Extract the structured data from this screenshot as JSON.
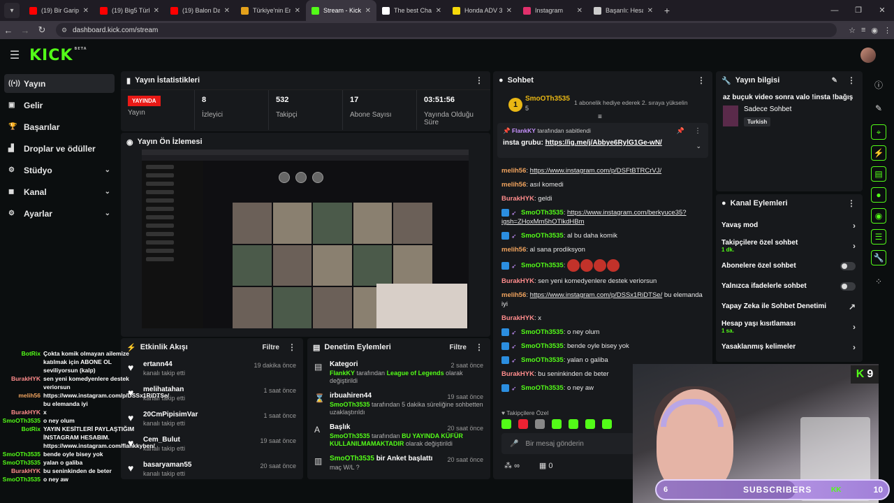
{
  "browser": {
    "tabs": [
      {
        "title": "(19) Bir Garip İ",
        "color": "#ff0000",
        "active": false
      },
      {
        "title": "(19) Big5 Türkiy",
        "color": "#ff0000",
        "active": false
      },
      {
        "title": "(19) Balon Data",
        "color": "#ff0000",
        "active": false
      },
      {
        "title": "Türkiye'nin En",
        "color": "#e4a11b",
        "active": false
      },
      {
        "title": "Stream - Kick D",
        "color": "#53fc18",
        "active": true
      },
      {
        "title": "The best Chatb",
        "color": "#ffffff",
        "active": false
      },
      {
        "title": "Honda ADV 350",
        "color": "#f5d90a",
        "active": false
      },
      {
        "title": "Instagram",
        "color": "#e1306c",
        "active": false
      },
      {
        "title": "Başarılı: Hesab",
        "color": "#cccccc",
        "active": false
      }
    ],
    "url": "dashboard.kick.com/stream"
  },
  "header": {
    "logo": "KICK",
    "beta": "BETA"
  },
  "sidebar": {
    "items": [
      {
        "label": "Yayın",
        "icon": "broadcast-icon",
        "active": true
      },
      {
        "label": "Gelir",
        "icon": "wallet-icon"
      },
      {
        "label": "Başarılar",
        "icon": "trophy-icon"
      },
      {
        "label": "Droplar ve ödüller",
        "icon": "gift-icon"
      },
      {
        "label": "Stüdyo",
        "icon": "studio-icon",
        "expandable": true
      },
      {
        "label": "Kanal",
        "icon": "channel-icon",
        "expandable": true
      },
      {
        "label": "Ayarlar",
        "icon": "settings-icon",
        "expandable": true
      }
    ]
  },
  "stats": {
    "title": "Yayın İstatistikleri",
    "live_badge": "YAYINDA",
    "items": [
      {
        "value": "",
        "label": "Yayın"
      },
      {
        "value": "8",
        "label": "İzleyici"
      },
      {
        "value": "532",
        "label": "Takipçi"
      },
      {
        "value": "17",
        "label": "Abone Sayısı"
      },
      {
        "value": "03:51:56",
        "label": "Yayında Olduğu Süre"
      }
    ]
  },
  "preview": {
    "title": "Yayın Ön İzlemesi"
  },
  "activity": {
    "title": "Etkinlik Akışı",
    "filter": "Filtre",
    "items": [
      {
        "name": "ertann44",
        "sub": "kanalı takip etti",
        "time": "19 dakika önce"
      },
      {
        "name": "melihatahan",
        "sub": "kanalı takip etti",
        "time": "1 saat önce"
      },
      {
        "name": "20CmPipisimVar",
        "sub": "kanalı takip etti",
        "time": "1 saat önce"
      },
      {
        "name": "Cem_Bulut",
        "sub": "kanalı takip etti",
        "time": "19 saat önce"
      },
      {
        "name": "basaryaman55",
        "sub": "kanalı takip etti",
        "time": "20 saat önce"
      }
    ]
  },
  "moderation": {
    "title": "Denetim Eylemleri",
    "filter": "Filtre",
    "items": [
      {
        "name": "Kategori",
        "user": "FlankKY",
        "mid": " tarafından ",
        "hl": "League of Legends",
        "rest": " olarak değiştirildi",
        "time": "2 saat önce",
        "icon": "category-icon"
      },
      {
        "name": "irbuahiren44",
        "user": "SmoOTh3535",
        "mid": " tarafından 5 dakika süreliğine sohbetten uzaklaştırıldı",
        "hl": "",
        "rest": "",
        "time": "19 saat önce",
        "icon": "hourglass-icon"
      },
      {
        "name": "Başlık",
        "user": "SmoOTh3535",
        "mid": " tarafından ",
        "hl": "BU YAYINDA KÜFÜR KULLANILMAMAKTADIR",
        "rest": " olarak değiştirildi",
        "time": "20 saat önce",
        "icon": "text-icon"
      },
      {
        "name": "bir Anket başlattı",
        "user": "SmoOTh3535",
        "mid": "maç W/L ?",
        "hl": "",
        "rest": "",
        "time": "20 saat önce",
        "icon": "poll-icon"
      }
    ]
  },
  "chat": {
    "title": "Sohbet",
    "top_gifter": {
      "name": "SmoOTh3535",
      "count": "5",
      "rank": "1",
      "text": "1 abonelik hediye ederek 2. sıraya yükselin"
    },
    "pinned": {
      "user": "FlankKY",
      "by": "tarafından sabitlendi",
      "label": "insta grubu:",
      "link": "https://ig.me/j/Abbye6RylG1Ge-wN/"
    },
    "messages": [
      {
        "user": "melih56",
        "color": "#f0a35e",
        "text": "",
        "link": "https://www.instagram.com/p/DSFtBTRCrVJ/",
        "badge": false
      },
      {
        "user": "melih56",
        "color": "#f0a35e",
        "text": "asıl komedi",
        "link": "",
        "badge": false
      },
      {
        "user": "BurakHYK",
        "color": "#ff8c8c",
        "text": "geldi",
        "link": "",
        "badge": false
      },
      {
        "user": "SmoOTh3535",
        "color": "#53fc18",
        "text": "",
        "link": "https://www.instagram.com/berkyuce35?igsh=ZHoxMm5hOTlkdHBm",
        "badge": true
      },
      {
        "user": "SmoOTh3535",
        "color": "#53fc18",
        "text": "al bu daha komik",
        "link": "",
        "badge": true
      },
      {
        "user": "melih56",
        "color": "#f0a35e",
        "text": "al sana prodiksyon",
        "link": "",
        "badge": false
      },
      {
        "user": "SmoOTh3535",
        "color": "#53fc18",
        "text": "",
        "link": "",
        "badge": true,
        "emotes": 4
      },
      {
        "user": "BurakHYK",
        "color": "#ff8c8c",
        "text": "sen yeni komedyenlere destek veriorsun",
        "link": "",
        "badge": false
      },
      {
        "user": "melih56",
        "color": "#f0a35e",
        "text": " bu elemanda iyi",
        "link": "https://www.instagram.com/p/DSSx1RiDTSe/",
        "badge": false
      },
      {
        "user": "BurakHYK",
        "color": "#ff8c8c",
        "text": "x",
        "link": "",
        "badge": false
      },
      {
        "user": "SmoOTh3535",
        "color": "#53fc18",
        "text": "o ney olum",
        "link": "",
        "badge": true
      },
      {
        "user": "SmoOTh3535",
        "color": "#53fc18",
        "text": "bende oyle bisey yok",
        "link": "",
        "badge": true
      },
      {
        "user": "SmoOTh3535",
        "color": "#53fc18",
        "text": "yalan o galiba",
        "link": "",
        "badge": true
      },
      {
        "user": "BurakHYK",
        "color": "#ff8c8c",
        "text": "bu seninkinden de beter",
        "link": "",
        "badge": false
      },
      {
        "user": "SmoOTh3535",
        "color": "#53fc18",
        "text": "o ney aw",
        "link": "",
        "badge": true
      }
    ],
    "followers_only": "Takipçilere Özel",
    "input_placeholder": "Bir mesaj gönderin",
    "viewer_count": "0",
    "infinity": "∞"
  },
  "stream_info": {
    "title": "Yayın bilgisi",
    "stream_title": "az buçuk video sonra valo !insta !bağış",
    "category": "Sadece Sohbet",
    "tag": "Turkish"
  },
  "channel_actions": {
    "title": "Kanal Eylemleri",
    "items": [
      {
        "label": "Yavaş mod",
        "sub": "",
        "control": "arrow"
      },
      {
        "label": "Takipçilere özel sohbet",
        "sub": "1 dk.",
        "control": "arrow"
      },
      {
        "label": "Abonelere özel sohbet",
        "sub": "",
        "control": "toggle"
      },
      {
        "label": "Yalnızca ifadelerle sohbet",
        "sub": "",
        "control": "toggle"
      },
      {
        "label": "Yapay Zeka ile Sohbet Denetimi",
        "sub": "",
        "control": "external"
      },
      {
        "label": "Hesap yaşı kısıtlaması",
        "sub": "1 sa.",
        "control": "arrow"
      },
      {
        "label": "Yasaklanmış kelimeler",
        "sub": "",
        "control": "arrow"
      }
    ]
  },
  "overlay_chat": [
    {
      "user": "BotRix",
      "color": "#53fc18",
      "text": "Çokta komik olmayan ailemize katılmak için ABONE OL seviliyorsun (kalp)"
    },
    {
      "user": "BurakHYK",
      "color": "#ff8c8c",
      "text": "sen yeni komedyenlere destek veriorsun"
    },
    {
      "user": "melih56",
      "color": "#f0a35e",
      "text": "https://www.instagram.com/p/DSSx1RiDTSe/ bu elemanda iyi"
    },
    {
      "user": "BurakHYK",
      "color": "#ff8c8c",
      "text": "x"
    },
    {
      "user": "SmoOTh3535",
      "color": "#53fc18",
      "text": "o ney olum"
    },
    {
      "user": "BotRix",
      "color": "#53fc18",
      "text": "YAYIN KESİTLERİ PAYLAŞTIĞIM İNSTAGRAM HESABIM. https://www.instagram.com/flankkyben/"
    },
    {
      "user": "SmoOTh3535",
      "color": "#53fc18",
      "text": "bende oyle bisey yok"
    },
    {
      "user": "SmoOTh3535",
      "color": "#53fc18",
      "text": "yalan o galiba"
    },
    {
      "user": "BurakHYK",
      "color": "#ff8c8c",
      "text": "bu seninkinden de beter"
    },
    {
      "user": "SmoOTh3535",
      "color": "#53fc18",
      "text": "o ney aw"
    }
  ],
  "webcam": {
    "kick_count": "9"
  },
  "sub_goal": {
    "current": "6",
    "label": "SUBSCRIBERS",
    "target": "10",
    "progress": 0.6
  }
}
